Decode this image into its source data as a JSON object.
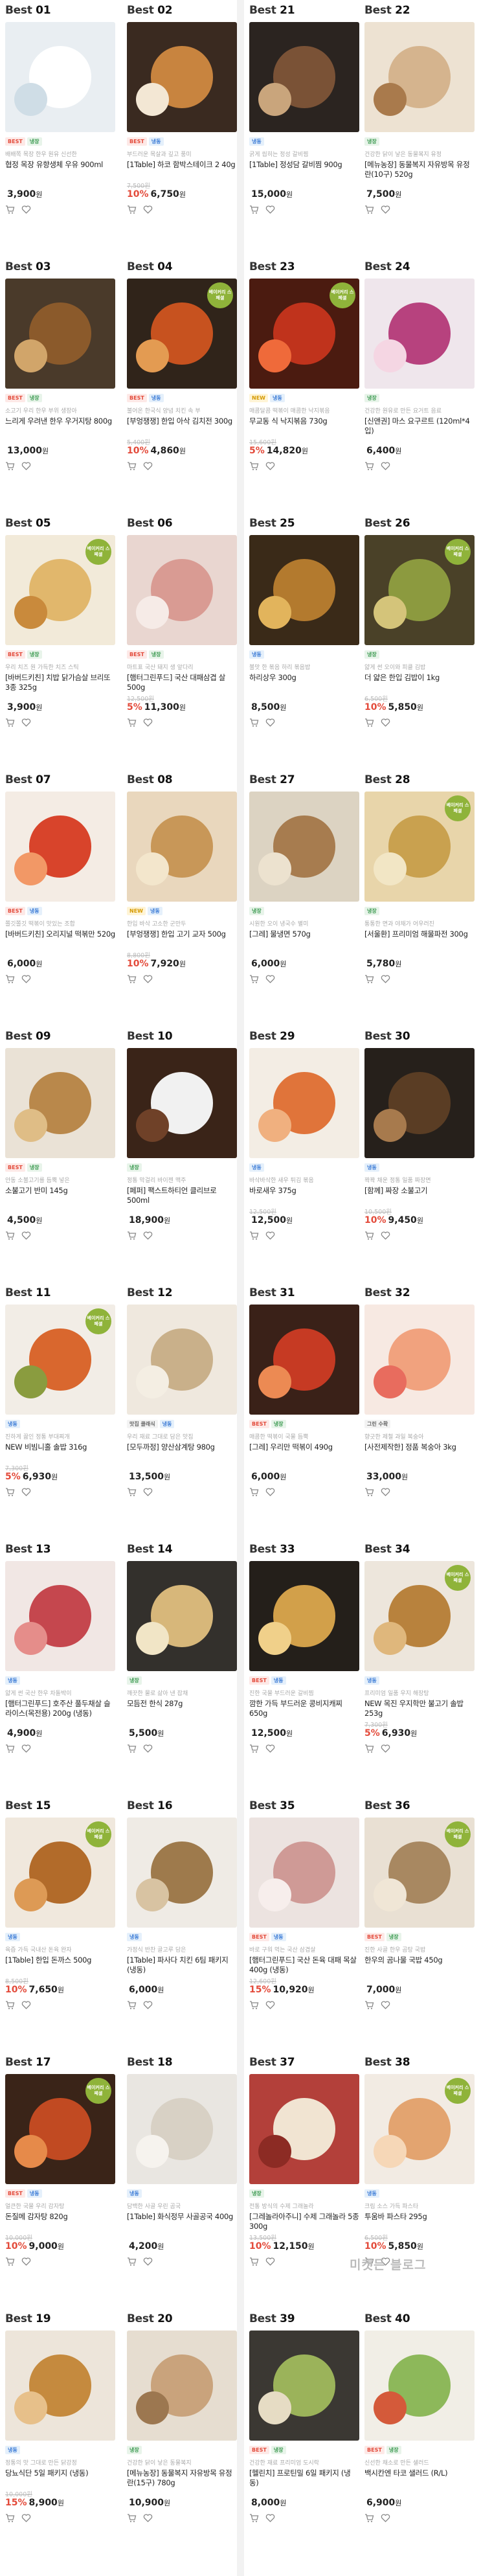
{
  "stamp_text": "베이커리 스페셜",
  "watermark": "미켓든 블로그",
  "won": "원",
  "items": [
    {
      "rank_label": "Best",
      "rank_num": "01",
      "badges": [
        {
          "t": "BEST",
          "c": "best"
        },
        {
          "t": "냉장",
          "c": "cold"
        }
      ],
      "desc": "배배쪽 목장 한우 원유 신선한",
      "name": "협정 목장 유향생체 우유 900ml",
      "orig": "",
      "disc": "",
      "price": "3,900",
      "stamp": false,
      "colors": [
        "#e9eef2",
        "#ffffff",
        "#cfdde6"
      ]
    },
    {
      "rank_label": "Best",
      "rank_num": "02",
      "badges": [
        {
          "t": "BEST",
          "c": "best"
        },
        {
          "t": "냉동",
          "c": "frozen"
        }
      ],
      "desc": "부드러운 목살과 깊고 풍미",
      "name": "[1Table] 하코 함박스테이크 2 40g",
      "orig": "7,500원",
      "disc": "10%",
      "price": "6,750",
      "stamp": false,
      "colors": [
        "#3a2a20",
        "#c8843f",
        "#f3e7d4"
      ]
    },
    {
      "rank_label": "Best",
      "rank_num": "21",
      "badges": [
        {
          "t": "냉동",
          "c": "frozen"
        }
      ],
      "desc": "굵게 씹히는 정성 갈비찜",
      "name": "[1Table] 정성담 갈비찜 900g",
      "orig": "",
      "disc": "",
      "price": "15,000",
      "stamp": false,
      "colors": [
        "#2b2420",
        "#7a5236",
        "#c9a57c"
      ]
    },
    {
      "rank_label": "Best",
      "rank_num": "22",
      "badges": [
        {
          "t": "냉장",
          "c": "cold"
        }
      ],
      "desc": "건강한 닭이 낳은 동물복지 유정",
      "name": "[메뉴농장] 동물복지 자유방목 유정란(10구) 520g",
      "orig": "",
      "disc": "",
      "price": "7,500",
      "stamp": false,
      "colors": [
        "#ede2d2",
        "#d5b48e",
        "#a97a4c"
      ]
    },
    {
      "rank_label": "Best",
      "rank_num": "03",
      "badges": [
        {
          "t": "BEST",
          "c": "best"
        },
        {
          "t": "냉장",
          "c": "cold"
        }
      ],
      "desc": "소고기 우리 한우 부위 생장아",
      "name": "느리게 우려낸 한우 우거지탕 800g",
      "orig": "",
      "disc": "",
      "price": "13,000",
      "stamp": false,
      "colors": [
        "#4a3a2a",
        "#8b5a2b",
        "#d1a56a"
      ]
    },
    {
      "rank_label": "Best",
      "rank_num": "04",
      "badges": [
        {
          "t": "BEST",
          "c": "best"
        },
        {
          "t": "냉동",
          "c": "frozen"
        }
      ],
      "desc": "불어온 한국식 양념 치킨 속 부",
      "name": "[부엉쟁쟁] 한입 아삭 김치전 300g",
      "orig": "5,400원",
      "disc": "10%",
      "price": "4,860",
      "stamp": true,
      "colors": [
        "#30241a",
        "#c7521f",
        "#e39b52"
      ]
    },
    {
      "rank_label": "Best",
      "rank_num": "23",
      "badges": [
        {
          "t": "NEW",
          "c": "new"
        },
        {
          "t": "냉동",
          "c": "frozen"
        }
      ],
      "desc": "매콤달콤 떡볶이 매콤한 낙지볶음",
      "name": "무교동 식 낙지볶음 730g",
      "orig": "15,600원",
      "disc": "5%",
      "price": "14,820",
      "stamp": true,
      "colors": [
        "#4b1b10",
        "#c0331c",
        "#ef6a3a"
      ]
    },
    {
      "rank_label": "Best",
      "rank_num": "24",
      "badges": [
        {
          "t": "냉장",
          "c": "cold"
        }
      ],
      "desc": "건강한 원유로 만든 요거트 음료",
      "name": "[신앤권] 마스 요구르트 (120ml*4입)",
      "orig": "",
      "disc": "",
      "price": "6,400",
      "stamp": false,
      "colors": [
        "#efe6ec",
        "#b7427e",
        "#f5d6e3"
      ]
    },
    {
      "rank_label": "Best",
      "rank_num": "05",
      "badges": [
        {
          "t": "BEST",
          "c": "best"
        },
        {
          "t": "냉장",
          "c": "cold"
        }
      ],
      "desc": "우리 치즈 원 가득한 치즈 스틱",
      "name": "[바버드키친] 치밥 닭가슴살 브리또 3종 325g",
      "orig": "",
      "disc": "",
      "price": "3,900",
      "stamp": true,
      "colors": [
        "#f2ead9",
        "#e1b76c",
        "#c98a3c"
      ]
    },
    {
      "rank_label": "Best",
      "rank_num": "06",
      "badges": [
        {
          "t": "BEST",
          "c": "best"
        },
        {
          "t": "냉장",
          "c": "cold"
        }
      ],
      "desc": "마트표 국산 돼지 생 앞다리",
      "name": "[햄터그린푸드] 국산 대패삼겹 살 500g",
      "orig": "12,500원",
      "disc": "5%",
      "price": "11,300",
      "stamp": false,
      "colors": [
        "#e9d6d0",
        "#d99b93",
        "#f6ebe7"
      ]
    },
    {
      "rank_label": "Best",
      "rank_num": "25",
      "badges": [
        {
          "t": "냉동",
          "c": "frozen"
        }
      ],
      "desc": "불맛 한 볶음 하리 볶음밥",
      "name": "하리상우 300g",
      "orig": "",
      "disc": "",
      "price": "8,500",
      "stamp": false,
      "colors": [
        "#3a2a18",
        "#b37a2e",
        "#e2b45c"
      ]
    },
    {
      "rank_label": "Best",
      "rank_num": "26",
      "badges": [
        {
          "t": "냉장",
          "c": "cold"
        }
      ],
      "desc": "얇게 썬 오이와 피클 김밥",
      "name": "더 얇은 한입 김밥이 1kg",
      "orig": "6,500원",
      "disc": "10%",
      "price": "5,850",
      "stamp": true,
      "colors": [
        "#4a4128",
        "#8c9a3f",
        "#d4c47a"
      ]
    },
    {
      "rank_label": "Best",
      "rank_num": "07",
      "badges": [
        {
          "t": "BEST",
          "c": "best"
        },
        {
          "t": "냉동",
          "c": "frozen"
        }
      ],
      "desc": "쫄깃쫄깃 떡볶이 맛있는 조합",
      "name": "[바버드키친] 오리지널 떡볶만 520g",
      "orig": "",
      "disc": "",
      "price": "6,000",
      "stamp": false,
      "colors": [
        "#f4ece4",
        "#d8442b",
        "#f29866"
      ]
    },
    {
      "rank_label": "Best",
      "rank_num": "08",
      "badges": [
        {
          "t": "NEW",
          "c": "new"
        },
        {
          "t": "냉동",
          "c": "frozen"
        }
      ],
      "desc": "한입 바삭 고소한 군만두",
      "name": "[부엉쟁쟁] 한입 고기 교자 500g",
      "orig": "8,800원",
      "disc": "10%",
      "price": "7,920",
      "stamp": false,
      "colors": [
        "#e9d7bd",
        "#c89758",
        "#f3e6cc"
      ]
    },
    {
      "rank_label": "Best",
      "rank_num": "27",
      "badges": [
        {
          "t": "냉장",
          "c": "cold"
        }
      ],
      "desc": "시원한 오이 냉국수 별미",
      "name": "[그레] 물냉면 570g",
      "orig": "",
      "disc": "",
      "price": "6,000",
      "stamp": false,
      "colors": [
        "#dcd3c2",
        "#a77c4f",
        "#ece2cf"
      ]
    },
    {
      "rank_label": "Best",
      "rank_num": "28",
      "badges": [
        {
          "t": "냉장",
          "c": "cold"
        }
      ],
      "desc": "통통한 면과 야채가 어우러진",
      "name": "[서울환] 프리미엄 해물파전 300g",
      "orig": "",
      "disc": "",
      "price": "5,780",
      "stamp": true,
      "colors": [
        "#e8d5aa",
        "#c9a14f",
        "#f2e6c5"
      ]
    },
    {
      "rank_label": "Best",
      "rank_num": "09",
      "badges": [
        {
          "t": "BEST",
          "c": "best"
        },
        {
          "t": "냉장",
          "c": "cold"
        }
      ],
      "desc": "안동 소불고기를 듬뿍 넣은",
      "name": "소불고기 반미 145g",
      "orig": "",
      "disc": "",
      "price": "4,500",
      "stamp": false,
      "colors": [
        "#eae2d6",
        "#b9884b",
        "#dfbd86"
      ]
    },
    {
      "rank_label": "Best",
      "rank_num": "10",
      "badges": [
        {
          "t": "냉장",
          "c": "cold"
        }
      ],
      "desc": "정통 막걸리 바이젠 맥주",
      "name": "[페퍼] 팩스트하티언 클리브로 500ml",
      "orig": "",
      "disc": "",
      "price": "18,900",
      "stamp": false,
      "colors": [
        "#3a2418",
        "#f1f1f1",
        "#6f4128"
      ]
    },
    {
      "rank_label": "Best",
      "rank_num": "29",
      "badges": [
        {
          "t": "냉동",
          "c": "frozen"
        }
      ],
      "desc": "바삭바삭한 새우 튀김 볶음",
      "name": "바로새우 375g",
      "orig": "12,500원",
      "disc": "",
      "price": "12,500",
      "stamp": false,
      "colors": [
        "#f3ede4",
        "#e0743a",
        "#f0b07f"
      ]
    },
    {
      "rank_label": "Best",
      "rank_num": "30",
      "badges": [
        {
          "t": "냉동",
          "c": "frozen"
        }
      ],
      "desc": "꽉꽉 채운 정통 일품 짜장면",
      "name": "[함께] 짜장 소불고기",
      "orig": "10,500원",
      "disc": "10%",
      "price": "9,450",
      "stamp": false,
      "colors": [
        "#26201b",
        "#5a3d24",
        "#a77a4d"
      ]
    },
    {
      "rank_label": "Best",
      "rank_num": "11",
      "badges": [
        {
          "t": "냉동",
          "c": "frozen"
        }
      ],
      "desc": "진하게 끓인 정통 부대찌개",
      "name": "NEW 비빔니홀 솔밥 316g",
      "orig": "7,300원",
      "disc": "5%",
      "price": "6,930",
      "stamp": true,
      "colors": [
        "#f2ede6",
        "#d9672e",
        "#8a9c3f"
      ]
    },
    {
      "rank_label": "Best",
      "rank_num": "12",
      "badges": [
        {
          "t": "맛집 클래식",
          "c": "plain"
        },
        {
          "t": "냉동",
          "c": "frozen"
        }
      ],
      "desc": "우리 재료 그대로 담은 맛집",
      "name": "[모두까정] 양산삼계탕 980g",
      "orig": "",
      "disc": "",
      "price": "13,500",
      "stamp": false,
      "colors": [
        "#efe8de",
        "#c9b08a",
        "#f4eee3"
      ]
    },
    {
      "rank_label": "Best",
      "rank_num": "31",
      "badges": [
        {
          "t": "BEST",
          "c": "best"
        },
        {
          "t": "냉장",
          "c": "cold"
        }
      ],
      "desc": "매콤한 떡볶이 국물 듬뿍",
      "name": "[그레] 우리만 떡볶이 490g",
      "orig": "",
      "disc": "",
      "price": "6,000",
      "stamp": false,
      "colors": [
        "#3a2118",
        "#c63a23",
        "#ec8a53"
      ]
    },
    {
      "rank_label": "Best",
      "rank_num": "32",
      "badges": [
        {
          "t": "그린 수확",
          "c": "plain"
        }
      ],
      "desc": "향긋한 제철 과일 복숭아",
      "name": "[사전제작한] 정품 복숭아 3kg",
      "orig": "",
      "disc": "",
      "price": "33,000",
      "stamp": false,
      "colors": [
        "#f7e9e2",
        "#f1a27e",
        "#e86c5e"
      ]
    },
    {
      "rank_label": "Best",
      "rank_num": "13",
      "badges": [
        {
          "t": "냉동",
          "c": "frozen"
        }
      ],
      "desc": "얇게 썬 국산 한우 차돌박이",
      "name": "[햄터그린푸드] 호주산 풀두채살 슬라이스(목전용) 200g (냉동)",
      "orig": "",
      "disc": "",
      "price": "4,900",
      "stamp": false,
      "colors": [
        "#f1e7e4",
        "#c5474e",
        "#e58d8a"
      ]
    },
    {
      "rank_label": "Best",
      "rank_num": "14",
      "badges": [
        {
          "t": "냉장",
          "c": "cold"
        }
      ],
      "desc": "깨끗한 물로 삶아 낸 잡채",
      "name": "모듬전 한식 287g",
      "orig": "",
      "disc": "",
      "price": "5,500",
      "stamp": false,
      "colors": [
        "#33302c",
        "#d7b77a",
        "#f1e5c6"
      ]
    },
    {
      "rank_label": "Best",
      "rank_num": "33",
      "badges": [
        {
          "t": "BEST",
          "c": "best"
        },
        {
          "t": "냉동",
          "c": "frozen"
        }
      ],
      "desc": "진한 국물 부드러운 갈비찜",
      "name": "깜한 가득 부드러운 콩비지캐찌 650g",
      "orig": "",
      "disc": "",
      "price": "12,500",
      "stamp": false,
      "colors": [
        "#241f1a",
        "#d2a04a",
        "#f0d08a"
      ]
    },
    {
      "rank_label": "Best",
      "rank_num": "34",
      "badges": [
        {
          "t": "냉동",
          "c": "frozen"
        }
      ],
      "desc": "프리미엄 일품 우지 해장탕",
      "name": "NEW 목진 우지학만 불고기 솔밥 253g",
      "orig": "7,300원",
      "disc": "5%",
      "price": "6,930",
      "stamp": true,
      "colors": [
        "#ede6dc",
        "#b8823d",
        "#dfb77c"
      ]
    },
    {
      "rank_label": "Best",
      "rank_num": "15",
      "badges": [
        {
          "t": "냉동",
          "c": "frozen"
        }
      ],
      "desc": "육즙 가득 국내산 돈육 완자",
      "name": "[1Table] 한입 돈까스 500g",
      "orig": "8,500원",
      "disc": "10%",
      "price": "7,650",
      "stamp": true,
      "colors": [
        "#f0e8dd",
        "#b26b2a",
        "#dd9a55"
      ]
    },
    {
      "rank_label": "Best",
      "rank_num": "16",
      "badges": [
        {
          "t": "냉동",
          "c": "frozen"
        }
      ],
      "desc": "가정식 반찬 골고루 담은",
      "name": "[1Table] 파사다 치킨 6팀 패키지 (냉동)",
      "orig": "",
      "disc": "",
      "price": "6,000",
      "stamp": false,
      "colors": [
        "#efebe5",
        "#9e7a4c",
        "#d8c3a2"
      ]
    },
    {
      "rank_label": "Best",
      "rank_num": "35",
      "badges": [
        {
          "t": "BEST",
          "c": "best"
        },
        {
          "t": "냉동",
          "c": "frozen"
        }
      ],
      "desc": "바로 구워 먹는 국산 삼겹살",
      "name": "[햄터그린푸드] 국산 돈육 대패 목살 400g (냉동)",
      "orig": "12,600원",
      "disc": "15%",
      "price": "10,920",
      "stamp": false,
      "colors": [
        "#ece3e0",
        "#cf9a96",
        "#f7eeec"
      ]
    },
    {
      "rank_label": "Best",
      "rank_num": "36",
      "badges": [
        {
          "t": "BEST",
          "c": "best"
        },
        {
          "t": "냉장",
          "c": "cold"
        }
      ],
      "desc": "진한 사골 한우 곰탕 국밥",
      "name": "한우의 곰나물 국밥 450g",
      "orig": "",
      "disc": "",
      "price": "7,000",
      "stamp": true,
      "colors": [
        "#e9e0d3",
        "#a88861",
        "#f0e6d6"
      ]
    },
    {
      "rank_label": "Best",
      "rank_num": "17",
      "badges": [
        {
          "t": "BEST",
          "c": "best"
        },
        {
          "t": "냉동",
          "c": "frozen"
        }
      ],
      "desc": "얼큰한 국물 우리 감자탕",
      "name": "돈질메 감자탕 820g",
      "orig": "10,000원",
      "disc": "10%",
      "price": "9,000",
      "stamp": true,
      "colors": [
        "#3a2418",
        "#c14a22",
        "#e68a4a"
      ]
    },
    {
      "rank_label": "Best",
      "rank_num": "18",
      "badges": [
        {
          "t": "냉동",
          "c": "frozen"
        }
      ],
      "desc": "담백한 사골 우린 곰국",
      "name": "[1Table] 화식정무 사골공국 400g",
      "orig": "",
      "disc": "",
      "price": "4,200",
      "stamp": false,
      "colors": [
        "#e9e6e1",
        "#d8d1c5",
        "#f6f3ee"
      ]
    },
    {
      "rank_label": "Best",
      "rank_num": "37",
      "badges": [
        {
          "t": "냉장",
          "c": "cold"
        }
      ],
      "desc": "전통 방식의 수제 그래놀라",
      "name": "[그레놀라아주니] 수제 그래놀라 5종 300g",
      "orig": "13,500원",
      "disc": "10%",
      "price": "12,150",
      "stamp": false,
      "colors": [
        "#b3403a",
        "#f1e4d2",
        "#8c2b24"
      ]
    },
    {
      "rank_label": "Best",
      "rank_num": "38",
      "badges": [
        {
          "t": "냉동",
          "c": "frozen"
        }
      ],
      "desc": "크림 소스 가득 파스타",
      "name": "투움바 파스타 295g",
      "orig": "6,500원",
      "disc": "10%",
      "price": "5,850",
      "stamp": true,
      "colors": [
        "#f2ebe3",
        "#e3a470",
        "#f6d7b7"
      ]
    },
    {
      "rank_label": "Best",
      "rank_num": "19",
      "badges": [
        {
          "t": "냉동",
          "c": "frozen"
        }
      ],
      "desc": "정통의 맛 그대로 만든 닭강정",
      "name": "당뇨식단 5일 패키지 (냉동)",
      "orig": "10,000원",
      "disc": "15%",
      "price": "8,900",
      "stamp": false,
      "colors": [
        "#ede5da",
        "#c58a3e",
        "#e7c08a"
      ]
    },
    {
      "rank_label": "Best",
      "rank_num": "20",
      "badges": [
        {
          "t": "냉장",
          "c": "cold"
        }
      ],
      "desc": "건강한 닭이 낳은 동물복지",
      "name": "[메뉴농장] 동물복지 자유방목 유정란(15구) 780g",
      "orig": "",
      "disc": "",
      "price": "10,900",
      "stamp": false,
      "colors": [
        "#e6ddd0",
        "#c9a37c",
        "#9c7750"
      ]
    },
    {
      "rank_label": "Best",
      "rank_num": "39",
      "badges": [
        {
          "t": "BEST",
          "c": "best"
        },
        {
          "t": "냉장",
          "c": "cold"
        }
      ],
      "desc": "건강한 재료 프리미엄 도시락",
      "name": "[헬린치] 프로틴밀 6일 패키지 (냉동)",
      "orig": "",
      "disc": "",
      "price": "8,000",
      "stamp": false,
      "colors": [
        "#3b3833",
        "#9bb35a",
        "#e6dcc4"
      ]
    },
    {
      "rank_label": "Best",
      "rank_num": "40",
      "badges": [
        {
          "t": "BEST",
          "c": "best"
        },
        {
          "t": "냉장",
          "c": "cold"
        }
      ],
      "desc": "신선한 채소로 만든 샐러드",
      "name": "백시칸엔 타코 샐러드 (R/L)",
      "orig": "",
      "disc": "",
      "price": "6,900",
      "stamp": false,
      "colors": [
        "#f1eee6",
        "#8db85a",
        "#d45a3a"
      ]
    }
  ]
}
